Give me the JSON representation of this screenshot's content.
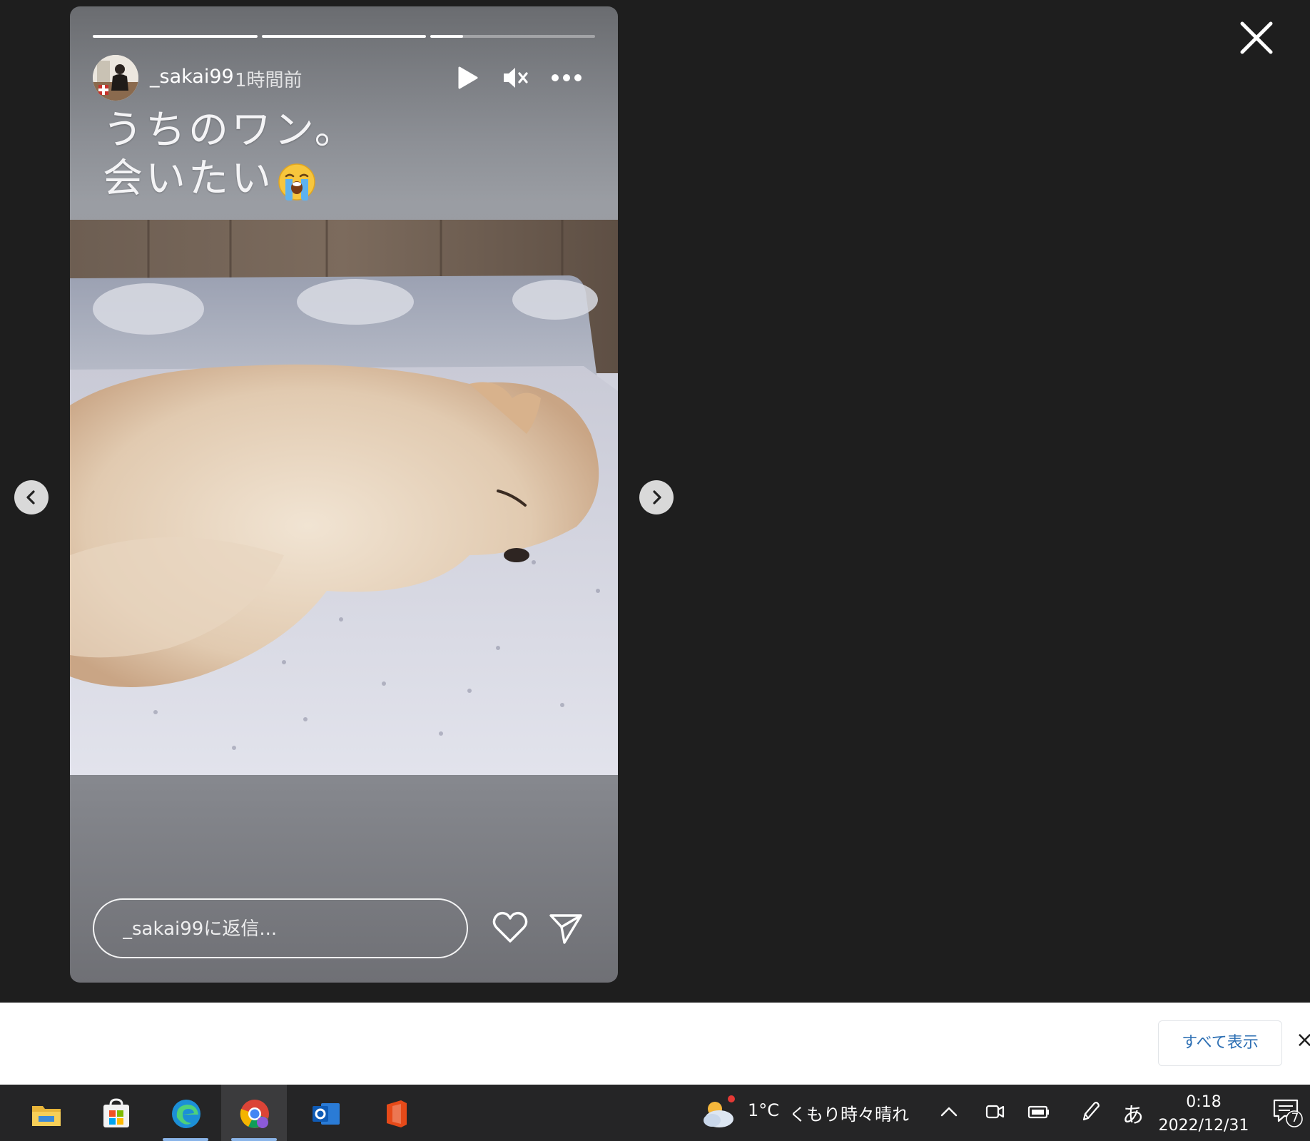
{
  "story": {
    "username": "_sakai99",
    "time_ago": "1時間前",
    "caption_line1": "うちのワン。",
    "caption_line2": "会いたい",
    "caption_emoji": "loudly-crying-face-emoji",
    "progress": [
      1.0,
      1.0,
      0.2
    ],
    "reply_placeholder": "_sakai99に返信...",
    "icons": [
      "play-icon",
      "mute-icon",
      "more-icon",
      "heart-icon",
      "send-icon",
      "close-icon"
    ]
  },
  "notification": {
    "show_all_label": "すべて表示",
    "close_label": "×"
  },
  "taskbar": {
    "apps": [
      "file-explorer-icon",
      "microsoft-store-icon",
      "edge-icon",
      "chrome-icon",
      "outlook-icon",
      "office-icon"
    ],
    "active_app": "chrome",
    "weather_temp": "1°C",
    "weather_desc": "くもり時々晴れ",
    "ime_label": "あ",
    "clock_time": "0:18",
    "clock_date": "2022/12/31",
    "notification_count": "7"
  },
  "colors": {
    "viewer_bg": "#1e1e1e",
    "taskbar_bg": "#252526",
    "link_blue": "#2d6fb3"
  }
}
